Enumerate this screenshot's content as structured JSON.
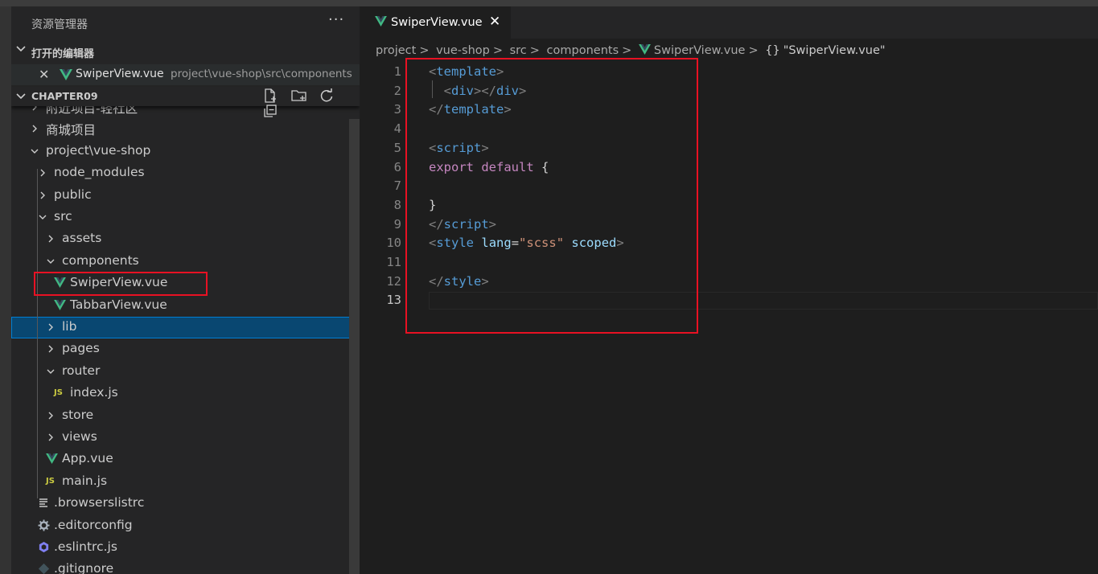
{
  "sidebar": {
    "title": "资源管理器",
    "more": "···",
    "open_editors": {
      "header": "打开的编辑器",
      "items": [
        {
          "close": "✕",
          "name": "SwiperView.vue",
          "path": "project\\vue-shop\\src\\components"
        }
      ]
    },
    "workspace": {
      "header": "CHAPTER09",
      "actions": [
        "new-file-icon",
        "new-folder-icon",
        "refresh-icon",
        "collapse-all-icon"
      ]
    },
    "tree": [
      {
        "label": "附近项目-轻社区",
        "type": "folder",
        "expanded": false,
        "depth": 0
      },
      {
        "label": "商城项目",
        "type": "folder",
        "expanded": false,
        "depth": 0
      },
      {
        "label": "project\\vue-shop",
        "type": "folder",
        "expanded": true,
        "depth": 0
      },
      {
        "label": "node_modules",
        "type": "folder",
        "expanded": false,
        "depth": 1
      },
      {
        "label": "public",
        "type": "folder",
        "expanded": false,
        "depth": 1
      },
      {
        "label": "src",
        "type": "folder",
        "expanded": true,
        "depth": 1
      },
      {
        "label": "assets",
        "type": "folder",
        "expanded": false,
        "depth": 2
      },
      {
        "label": "components",
        "type": "folder",
        "expanded": true,
        "depth": 2
      },
      {
        "label": "SwiperView.vue",
        "type": "vue",
        "depth": 3
      },
      {
        "label": "TabbarView.vue",
        "type": "vue",
        "depth": 3
      },
      {
        "label": "lib",
        "type": "folder",
        "expanded": false,
        "depth": 2
      },
      {
        "label": "pages",
        "type": "folder",
        "expanded": false,
        "depth": 2
      },
      {
        "label": "router",
        "type": "folder",
        "expanded": true,
        "depth": 2
      },
      {
        "label": "index.js",
        "type": "js",
        "depth": 3
      },
      {
        "label": "store",
        "type": "folder",
        "expanded": false,
        "depth": 2
      },
      {
        "label": "views",
        "type": "folder",
        "expanded": false,
        "depth": 2
      },
      {
        "label": "App.vue",
        "type": "vue",
        "depth": 2
      },
      {
        "label": "main.js",
        "type": "js",
        "depth": 2
      },
      {
        "label": ".browserslistrc",
        "type": "text",
        "depth": 1
      },
      {
        "label": ".editorconfig",
        "type": "gear",
        "depth": 1
      },
      {
        "label": ".eslintrc.js",
        "type": "eslint",
        "depth": 1
      },
      {
        "label": ".gitignore",
        "type": "git",
        "depth": 1
      }
    ],
    "js_badge": "JS"
  },
  "editor": {
    "tab": {
      "name": "SwiperView.vue",
      "close": "✕"
    },
    "breadcrumbs": [
      "project",
      "vue-shop",
      "src",
      "components",
      "SwiperView.vue",
      "\"SwiperView.vue\""
    ],
    "breadcrumb_sep": ">",
    "breadcrumb_symbol": "{}",
    "active_line": 13,
    "lines": [
      {
        "n": "1",
        "tokens": [
          [
            "br",
            "<"
          ],
          [
            "tag",
            "template"
          ],
          [
            "br",
            ">"
          ]
        ]
      },
      {
        "n": "2",
        "tokens": [
          [
            "pun",
            "  "
          ],
          [
            "br",
            "<"
          ],
          [
            "tag",
            "div"
          ],
          [
            "br",
            "></"
          ],
          [
            "tag",
            "div"
          ],
          [
            "br",
            ">"
          ]
        ]
      },
      {
        "n": "3",
        "tokens": [
          [
            "br",
            "</"
          ],
          [
            "tag",
            "template"
          ],
          [
            "br",
            ">"
          ]
        ]
      },
      {
        "n": "4",
        "tokens": []
      },
      {
        "n": "5",
        "tokens": [
          [
            "br",
            "<"
          ],
          [
            "tag",
            "script"
          ],
          [
            "br",
            ">"
          ]
        ]
      },
      {
        "n": "6",
        "tokens": [
          [
            "kw",
            "export"
          ],
          [
            "pun",
            " "
          ],
          [
            "kw",
            "default"
          ],
          [
            "pun",
            " {"
          ]
        ]
      },
      {
        "n": "7",
        "tokens": []
      },
      {
        "n": "8",
        "tokens": [
          [
            "pun",
            "}"
          ]
        ]
      },
      {
        "n": "9",
        "tokens": [
          [
            "br",
            "</"
          ],
          [
            "tag",
            "script"
          ],
          [
            "br",
            ">"
          ]
        ]
      },
      {
        "n": "10",
        "tokens": [
          [
            "br",
            "<"
          ],
          [
            "tag",
            "style"
          ],
          [
            "pun",
            " "
          ],
          [
            "attr",
            "lang"
          ],
          [
            "pun",
            "="
          ],
          [
            "str",
            "\"scss\""
          ],
          [
            "pun",
            " "
          ],
          [
            "attr",
            "scoped"
          ],
          [
            "br",
            ">"
          ]
        ]
      },
      {
        "n": "11",
        "tokens": []
      },
      {
        "n": "12",
        "tokens": [
          [
            "br",
            "</"
          ],
          [
            "tag",
            "style"
          ],
          [
            "br",
            ">"
          ]
        ]
      },
      {
        "n": "13",
        "tokens": []
      }
    ]
  },
  "colors": {
    "vue_green": "#41b883",
    "highlight_red": "#e81123",
    "selection_blue": "#094771"
  }
}
